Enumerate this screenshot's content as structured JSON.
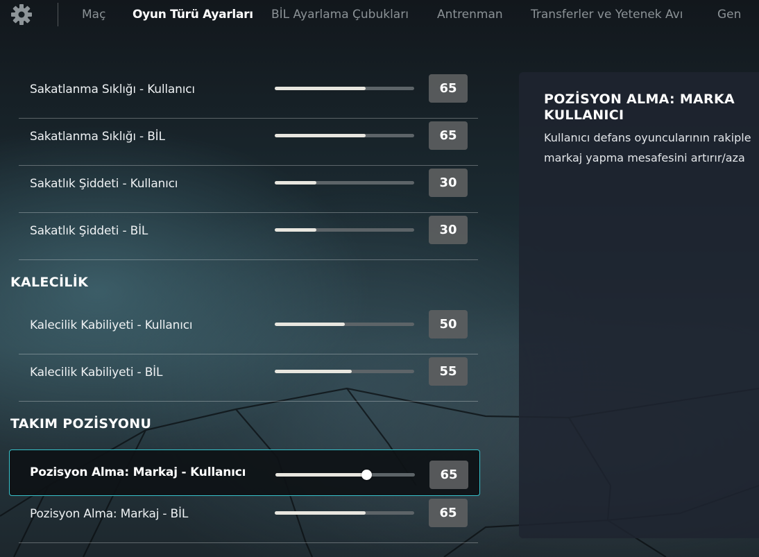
{
  "nav": {
    "tabs": [
      {
        "label": "Maç",
        "active": false
      },
      {
        "label": "Oyun Türü Ayarları",
        "active": true
      },
      {
        "label": "BİL Ayarlama Çubukları",
        "active": false
      },
      {
        "label": "Antrenman",
        "active": false
      },
      {
        "label": "Transferler ve Yetenek Avı",
        "active": false
      },
      {
        "label": "Gen",
        "active": false
      }
    ]
  },
  "settings": {
    "rows": [
      {
        "label": "Sakatlanma Sıklığı - Kullanıcı",
        "value": "65"
      },
      {
        "label": "Sakatlanma Sıklığı - BİL",
        "value": "65"
      },
      {
        "label": "Sakatlık Şiddeti - Kullanıcı",
        "value": "30"
      },
      {
        "label": "Sakatlık Şiddeti - BİL",
        "value": "30"
      }
    ],
    "goalkeeping": {
      "heading": "KALECİLİK",
      "rows": [
        {
          "label": "Kalecilik Kabiliyeti - Kullanıcı",
          "value": "50"
        },
        {
          "label": "Kalecilik Kabiliyeti - BİL",
          "value": "55"
        }
      ]
    },
    "team_positioning": {
      "heading": "TAKIM POZİSYONU",
      "rows": [
        {
          "label": "Pozisyon Alma: Markaj - Kullanıcı",
          "value": "65",
          "selected": true
        },
        {
          "label": "Pozisyon Alma: Markaj - BİL",
          "value": "65"
        }
      ]
    }
  },
  "panel": {
    "title_lines": [
      "POZİSYON ALMA: MARKA",
      "KULLANICI"
    ],
    "body_lines": [
      "Kullanıcı defans oyuncularının rakiple",
      "markaj yapma mesafesini artırır/aza"
    ]
  },
  "colors": {
    "accent": "#38c3cc",
    "slider_fill": "#e8e6df",
    "slider_track": "#5d6468",
    "value_box": "#5c5e60"
  },
  "icons": {
    "settings": "gear-icon"
  }
}
